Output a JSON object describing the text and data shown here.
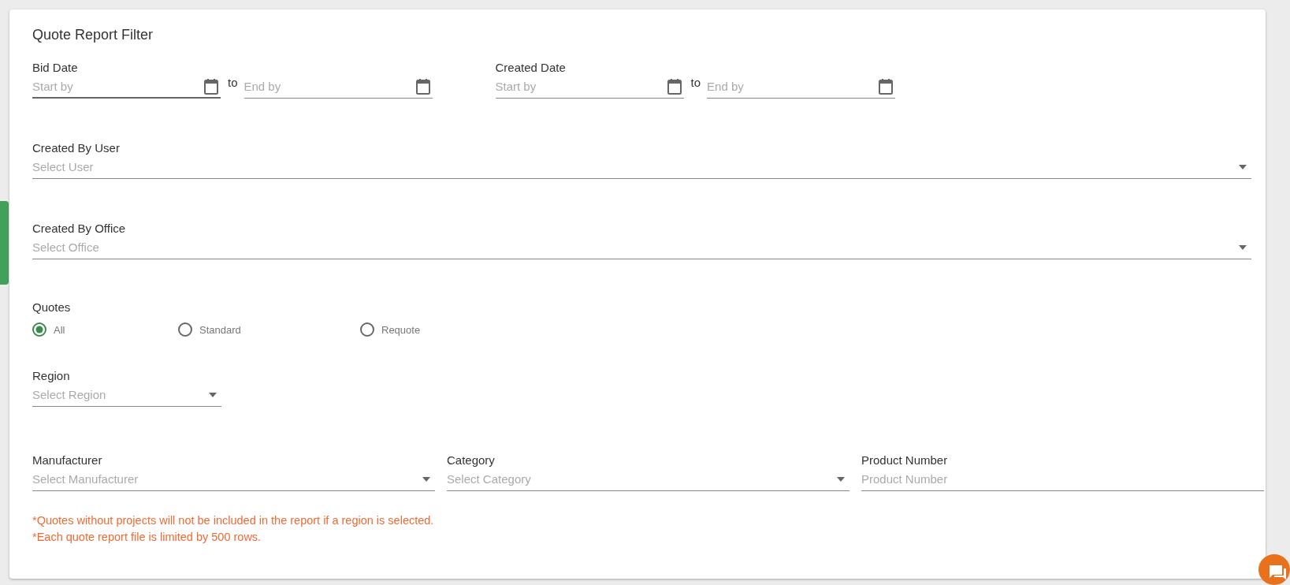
{
  "title": "Quote Report Filter",
  "date_ranges": [
    {
      "label": "Bid Date",
      "start": {
        "placeholder": "Start by"
      },
      "separator": "to",
      "end": {
        "placeholder": "End by"
      }
    },
    {
      "label": "Created Date",
      "start": {
        "placeholder": "Start by"
      },
      "separator": "to",
      "end": {
        "placeholder": "End by"
      }
    }
  ],
  "created_by_user": {
    "label": "Created By User",
    "placeholder": "Select User"
  },
  "created_by_office": {
    "label": "Created By Office",
    "placeholder": "Select Office"
  },
  "quotes": {
    "label": "Quotes",
    "options": [
      {
        "label": "All",
        "selected": true
      },
      {
        "label": "Standard",
        "selected": false
      },
      {
        "label": "Requote",
        "selected": false
      }
    ]
  },
  "region": {
    "label": "Region",
    "placeholder": "Select Region"
  },
  "filters": [
    {
      "kind": "select",
      "label": "Manufacturer",
      "placeholder": "Select Manufacturer"
    },
    {
      "kind": "select",
      "label": "Category",
      "placeholder": "Select Category"
    },
    {
      "kind": "text",
      "label": "Product Number",
      "placeholder": "Product Number"
    }
  ],
  "notes": [
    "*Quotes without projects will not be included in the report if a region is selected.",
    "*Each quote report file is limited by 500 rows."
  ]
}
